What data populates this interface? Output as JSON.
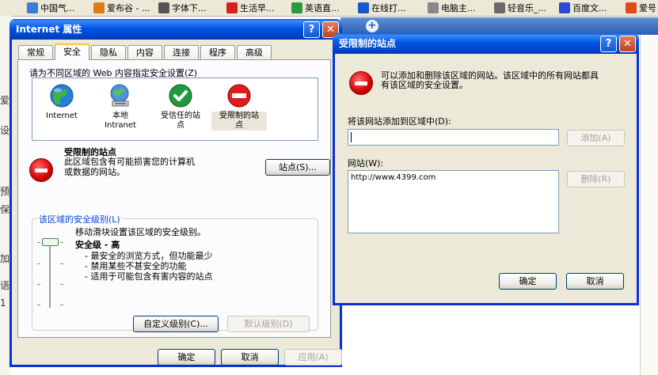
{
  "favorites": [
    {
      "label": "中国气...",
      "icon": "favicon-weather",
      "color": "#3b7dd8"
    },
    {
      "label": "爱布谷 - ...",
      "icon": "favicon-aibugu",
      "color": "#e07b1a"
    },
    {
      "label": "字体下...",
      "icon": "favicon-font",
      "color": "#555555"
    },
    {
      "label": "生活早...",
      "icon": "favicon-life",
      "color": "#d62020"
    },
    {
      "label": "英语直...",
      "icon": "favicon-english",
      "color": "#2a9a3a"
    },
    {
      "label": "在线打...",
      "icon": "favicon-ku",
      "color": "#1a57c8"
    },
    {
      "label": "电脑主...",
      "icon": "favicon-computer",
      "color": "#888888"
    },
    {
      "label": "轻音乐_...",
      "icon": "favicon-music",
      "color": "#6a6a6a"
    },
    {
      "label": "百度文...",
      "icon": "favicon-baidu",
      "color": "#2b4bd6"
    },
    {
      "label": "爱号",
      "icon": "favicon-aihao",
      "color": "#e04a1a"
    }
  ],
  "background_fragments": [
    "爱",
    "设",
    "预",
    "保",
    "加",
    "语",
    "1"
  ],
  "internet_properties": {
    "title": "Internet 属性",
    "tabs": [
      "常规",
      "安全",
      "隐私",
      "内容",
      "连接",
      "程序",
      "高级"
    ],
    "active_tab": "安全",
    "zones_prompt": "请为不同区域的 Web 内容指定安全设置(Z)",
    "zones": [
      {
        "label": "Internet",
        "icon": "globe-icon"
      },
      {
        "label": "本地\nIntranet",
        "icon": "local-intranet-icon"
      },
      {
        "label": "受信任的站\n点",
        "icon": "trusted-sites-icon"
      },
      {
        "label": "受限制的站\n点",
        "icon": "restricted-sites-icon"
      }
    ],
    "selected_zone_title": "受限制的站点",
    "selected_zone_desc": "此区域包含有可能损害您的计算机\n或数据的网站。",
    "sites_button": "站点(S)...",
    "group_title": "该区域的安全级别(L)",
    "slider_hint": "移动滑块设置该区域的安全级别。",
    "level_title": "安全级 - 高",
    "level_points": [
      "- 最安全的浏览方式，但功能最少",
      "- 禁用某些不甚安全的功能",
      "- 适用于可能包含有害内容的站点"
    ],
    "slider_level": "高",
    "custom_button": "自定义级别(C)...",
    "default_button": "默认级别(D)",
    "ok": "确定",
    "cancel": "取消",
    "apply": "应用(A)"
  },
  "restricted_sites": {
    "title": "受限制的站点",
    "info": "可以添加和删除该区域的网站。该区域中的所有网站都具\n有该区域的安全设置。",
    "add_label": "将该网站添加到区域中(D):",
    "add_value": "",
    "add_button": "添加(A)",
    "sites_label": "网站(W):",
    "sites": [
      "http://www.4399.com"
    ],
    "remove_button": "删除(R)",
    "ok": "确定",
    "cancel": "取消"
  },
  "colors": {
    "title_bar": "#0054e3",
    "dialog_bg": "#ece9d8",
    "group_title": "#0046d5"
  }
}
